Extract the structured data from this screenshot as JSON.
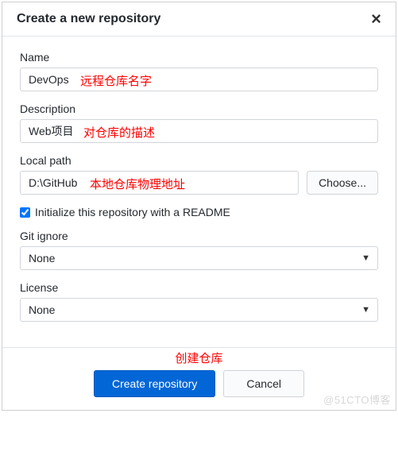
{
  "header": {
    "title": "Create a new repository",
    "close": "×"
  },
  "fields": {
    "name": {
      "label": "Name",
      "value": "DevOps",
      "annotation": "远程仓库名字"
    },
    "description": {
      "label": "Description",
      "value": "Web项目",
      "annotation": "对仓库的描述"
    },
    "localPath": {
      "label": "Local path",
      "value": "D:\\GitHub",
      "chooseLabel": "Choose...",
      "annotation": "本地仓库物理地址"
    },
    "initReadme": {
      "label": "Initialize this repository with a README",
      "checked": true
    },
    "gitIgnore": {
      "label": "Git ignore",
      "value": "None"
    },
    "license": {
      "label": "License",
      "value": "None"
    }
  },
  "footer": {
    "annotation": "创建仓库",
    "createLabel": "Create repository",
    "cancelLabel": "Cancel"
  },
  "watermark": "@51CTO博客"
}
